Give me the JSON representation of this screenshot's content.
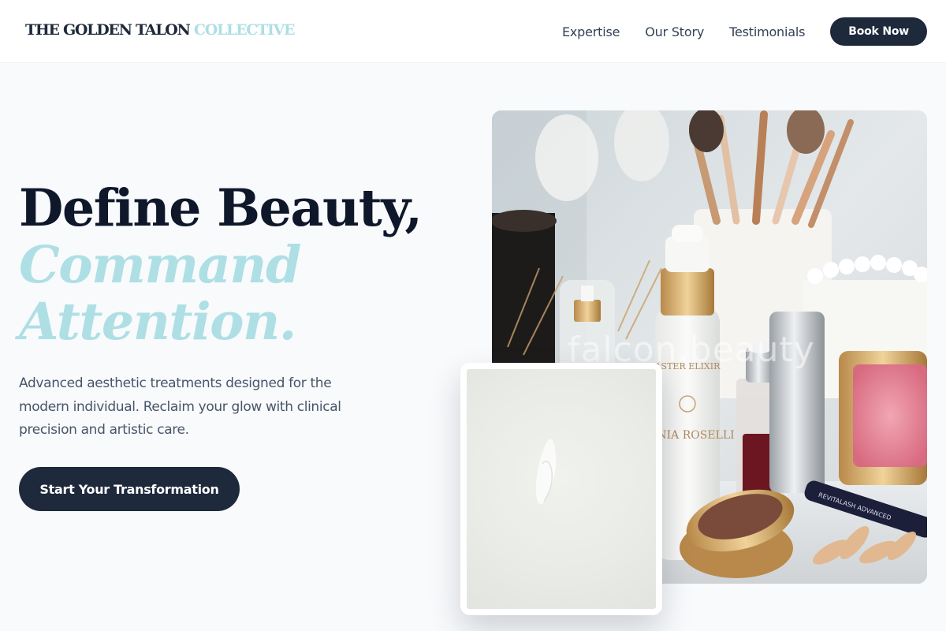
{
  "brand": {
    "name_part1": "THE GOLDEN TALON",
    "name_part2": "COLLECTIVE"
  },
  "nav": {
    "links": [
      "Expertise",
      "Our Story",
      "Testimonials"
    ],
    "cta_label": "Book Now"
  },
  "hero": {
    "title_line1": "Define Beauty,",
    "title_line2": "Command",
    "title_line3": "Attention.",
    "description": "Advanced aesthetic treatments designed for the modern individual. Reclaim your glow with clinical precision and artistic care.",
    "cta_label": "Start Your Transformation"
  },
  "image": {
    "watermark": "falcon.beauty",
    "labels": {
      "bottle_brand": "SONIA ROSELLI",
      "bottle_top": "ASTER ELIXIR",
      "mascara": "REVITALASH ADVANCED"
    }
  },
  "colors": {
    "accent": "#aedfe5",
    "navy": "#1e293b",
    "text_muted": "#475569",
    "background": "#f8fafc"
  },
  "icons": []
}
